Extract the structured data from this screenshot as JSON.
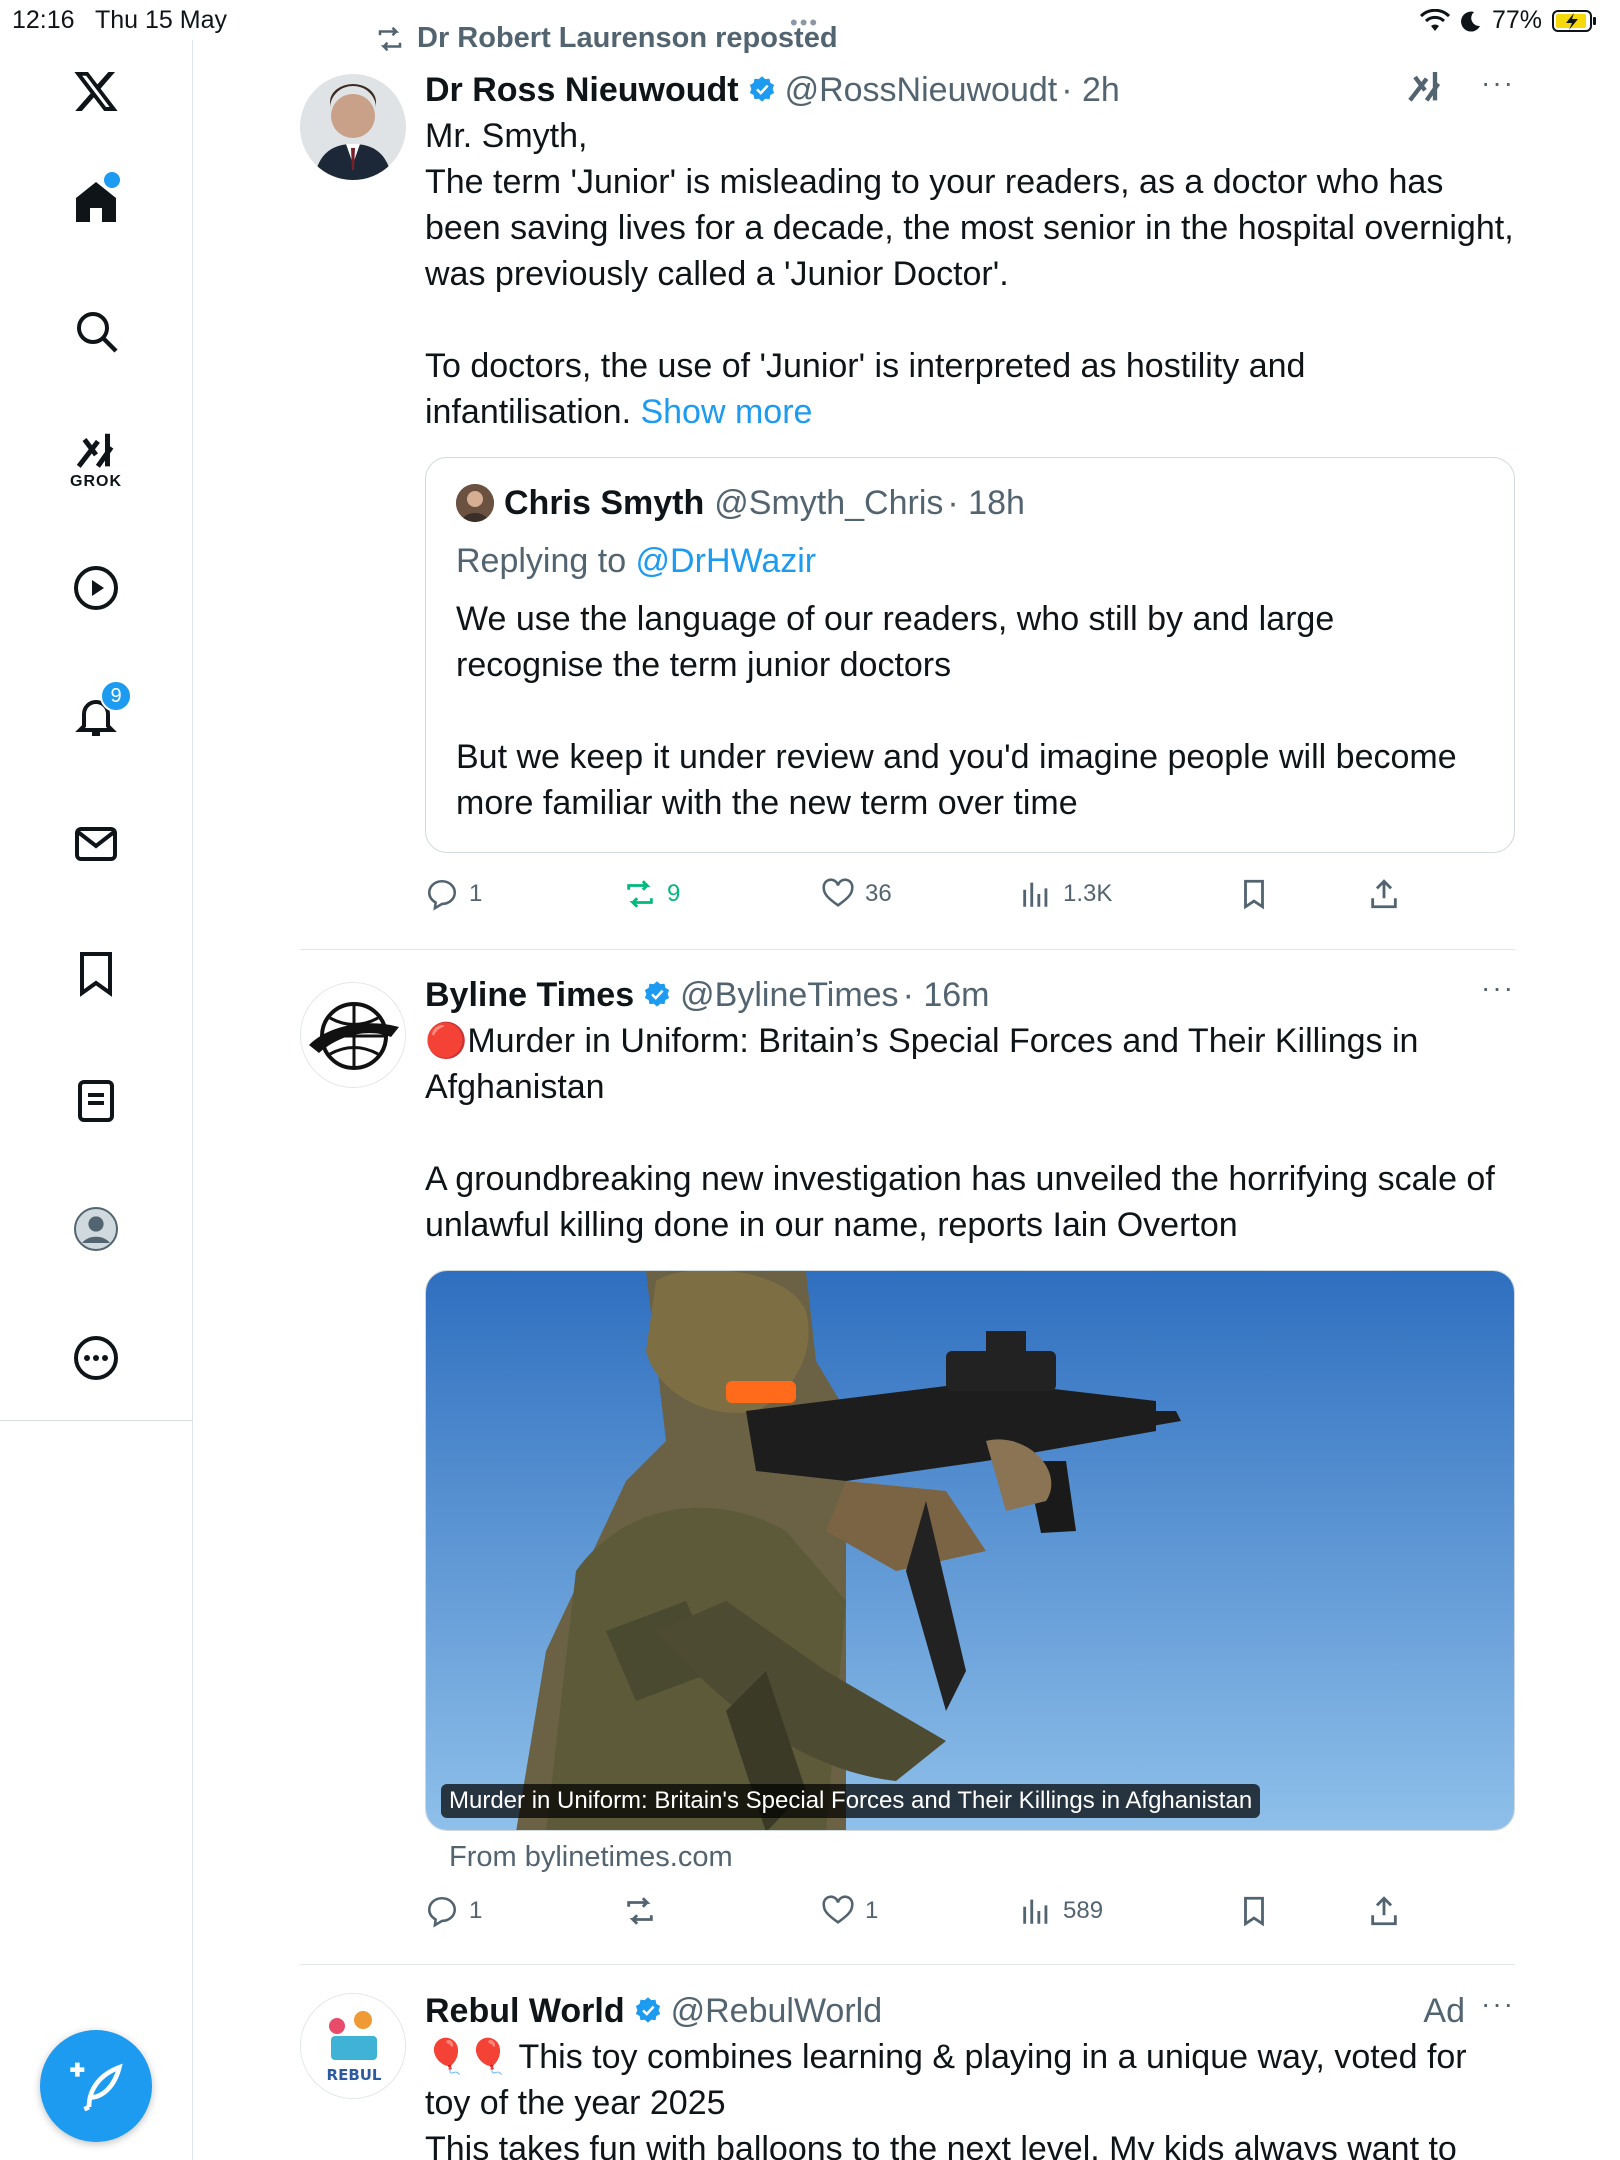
{
  "status_bar": {
    "time": "12:16",
    "date": "Thu 15 May",
    "battery": "77%"
  },
  "sidebar": {
    "grok_label": "GROK",
    "notifications_badge": "9",
    "icons": [
      "x-logo-icon",
      "home-icon",
      "search-icon",
      "grok-icon",
      "video-icon",
      "bell-icon",
      "mail-icon",
      "bookmark-icon",
      "list-icon",
      "profile-icon",
      "more-icon",
      "compose-icon"
    ]
  },
  "colors": {
    "accent": "#1d9bf0",
    "retweet_green": "#00ba7c",
    "secondary_text": "#536471"
  },
  "tweets": [
    {
      "repost_label": "Dr Robert Laurenson reposted",
      "name": "Dr Ross Nieuwoudt",
      "handle": "@RossNieuwoudt",
      "time": "· 2h",
      "text_1": "Mr. Smyth,\nThe term 'Junior' is misleading to your readers, as a doctor who has been saving lives for a decade, the most senior in the hospital overnight, was previously called a 'Junior Doctor'.\n\nTo doctors, the use of 'Junior' is interpreted as hostility and infantilisation. ",
      "show_more": "Show more",
      "quote": {
        "name": "Chris Smyth",
        "handle": "@Smyth_Chris",
        "time": "· 18h",
        "replying_prefix": "Replying to ",
        "replying_to": "@DrHWazir",
        "text": "We use the language of our readers, who still by and large recognise the term junior doctors\n\nBut we keep it under review and you'd imagine people will become more familiar with the new term over time"
      },
      "stats": {
        "replies": "1",
        "reposts": "9",
        "likes": "36",
        "views": "1.3K"
      }
    },
    {
      "name": "Byline Times",
      "handle": "@BylineTimes",
      "time": "· 16m",
      "text": "🔴Murder in Uniform: Britain’s Special Forces and Their Killings in Afghanistan\n\nA groundbreaking new investigation has unveiled the horrifying scale of unlawful killing done in our name, reports Iain Overton",
      "media_caption": "Murder in Uniform: Britain's Special Forces and Their Killings in Afghanistan",
      "from_line": "From bylinetimes.com",
      "stats": {
        "replies": "1",
        "reposts": "",
        "likes": "1",
        "views": "589"
      }
    },
    {
      "name": "Rebul World",
      "handle": "@RebulWorld",
      "ad_label": "Ad",
      "text": "🎈🎈 This toy combines learning & playing in a unique way, voted for toy of the year 2025\nThis takes fun with balloons to the next level. My kids always want to"
    }
  ]
}
